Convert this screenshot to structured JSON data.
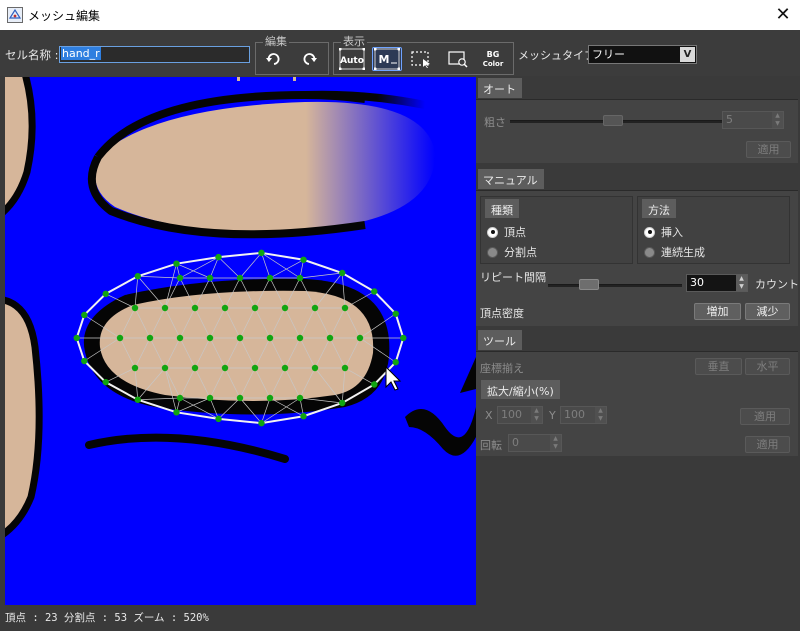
{
  "window": {
    "title": "メッシュ編集",
    "close_glyph": "✕"
  },
  "toolbar": {
    "cell_name_label": "セル名称 :",
    "cell_name_value": "hand_r",
    "edit_group_title": "編集",
    "view_group_title": "表示",
    "undo_icon": "undo-icon",
    "redo_icon": "redo-icon",
    "auto_label": "Auto",
    "manual_label": "M",
    "bg_label_top": "BG",
    "bg_label_bottom": "Color",
    "mesh_type_label": "メッシュタイプ :",
    "mesh_type_value": "フリー",
    "mesh_type_arrow": "V"
  },
  "status": {
    "text": "頂点 : 23  分割点 : 53  ズーム : 520%"
  },
  "colors": {
    "canvas_bg": "#0000ff",
    "skin": "#d6b69a",
    "mesh_line": "#c8c8c8",
    "mesh_point": "#11a511",
    "outline": "#050505"
  },
  "auto": {
    "header": "オート",
    "roughness_label": "粗さ",
    "roughness_value": "5",
    "apply_label": "適用"
  },
  "manual": {
    "header": "マニュアル",
    "type_header": "種類",
    "type_options": [
      "頂点",
      "分割点"
    ],
    "type_selected": "頂点",
    "method_header": "方法",
    "method_options": [
      "挿入",
      "連続生成"
    ],
    "method_selected": "挿入",
    "repeat_label": "リピート間隔",
    "repeat_value": "30",
    "repeat_unit": "カウント",
    "density_label": "頂点密度",
    "increase_label": "増加",
    "decrease_label": "減少"
  },
  "tools": {
    "header": "ツール",
    "align_label": "座標揃え",
    "vertical_label": "垂直",
    "horizontal_label": "水平",
    "scale_header": "拡大/縮小(%)",
    "x_label": "X",
    "x_value": "100",
    "y_label": "Y",
    "y_value": "100",
    "apply_label": "適用",
    "rotate_label": "回転",
    "rotate_value": "0",
    "apply2_label": "適用"
  }
}
